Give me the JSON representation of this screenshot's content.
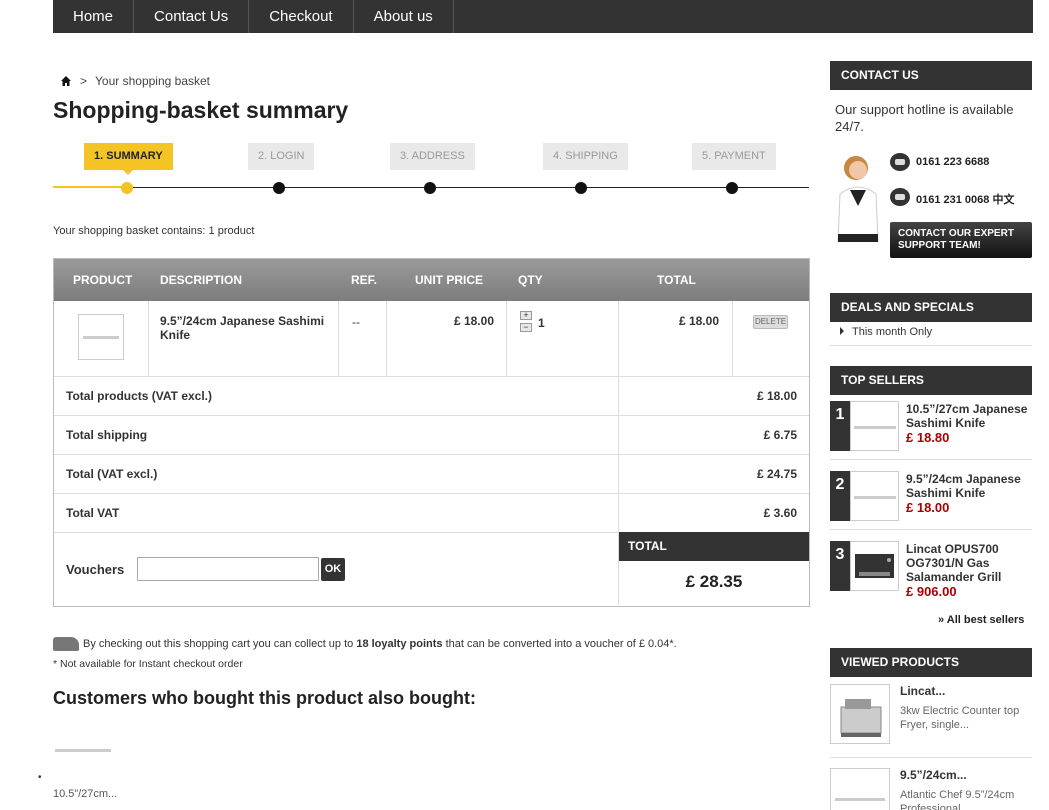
{
  "nav": {
    "items": [
      "Home",
      "Contact Us",
      "Checkout",
      "About us"
    ]
  },
  "breadcrumb": {
    "sep": ">",
    "current": "Your shopping basket"
  },
  "page_title": "Shopping-basket summary",
  "steps": [
    "1. SUMMARY",
    "2. LOGIN",
    "3. ADDRESS",
    "4. SHIPPING",
    "5. PAYMENT"
  ],
  "contains": "Your shopping basket contains: 1 product",
  "table": {
    "headers": {
      "product": "PRODUCT",
      "description": "DESCRIPTION",
      "ref": "REF.",
      "unit_price": "UNIT PRICE",
      "qty": "QTY",
      "total": "TOTAL"
    },
    "row": {
      "description": "9.5”/24cm Japanese Sashimi Knife",
      "ref": "--",
      "unit_price": "£ 18.00",
      "qty": "1",
      "total": "£ 18.00",
      "delete": "DELETE",
      "plus": "+",
      "minus": "−"
    }
  },
  "summary": [
    {
      "label": "Total products (VAT excl.)",
      "value": "£ 18.00"
    },
    {
      "label": "Total shipping",
      "value": "£ 6.75"
    },
    {
      "label": "Total (VAT excl.)",
      "value": "£ 24.75"
    },
    {
      "label": "Total VAT",
      "value": "£ 3.60"
    }
  ],
  "voucher": {
    "label": "Vouchers",
    "value": "",
    "ok": "OK"
  },
  "total": {
    "label": "TOTAL",
    "value": "£ 28.35"
  },
  "loyalty": {
    "pre": "By checking out this shopping cart you can collect up to ",
    "points": "18 loyalty points",
    "post": " that can be converted into a voucher of £ 0.04*."
  },
  "note": "* Not available for Instant checkout order",
  "also": {
    "title": "Customers who bought this product also bought:",
    "bullet": "•",
    "label": "10.5”/27cm..."
  },
  "sidebar": {
    "contact": {
      "title": "CONTACT US",
      "text": "Our support hotline is available 24/7.",
      "phone1": "0161 223 6688",
      "phone2": "0161 231 0068 中文",
      "button": "CONTACT OUR EXPERT SUPPORT TEAM!"
    },
    "deals": {
      "title": "DEALS AND SPECIALS",
      "item": "This month Only"
    },
    "top_sellers": {
      "title": "TOP SELLERS",
      "items": [
        {
          "rank": "1",
          "name": "10.5”/27cm Japanese Sashimi Knife",
          "price": "£ 18.80"
        },
        {
          "rank": "2",
          "name": "9.5”/24cm Japanese Sashimi Knife",
          "price": "£ 18.00"
        },
        {
          "rank": "3",
          "name": "Lincat OPUS700 OG7301/N Gas Salamander Grill",
          "price": "£ 906.00"
        }
      ],
      "all": "» All best sellers"
    },
    "viewed": {
      "title": "VIEWED PRODUCTS",
      "items": [
        {
          "name": "Lincat...",
          "desc": "3kw Electric Counter top Fryer, single..."
        },
        {
          "name": "9.5”/24cm...",
          "desc": "Atlantic Chef 9.5”/24cm Professional"
        }
      ]
    }
  },
  "colors": {
    "accent": "#f4c425",
    "dark": "#333333",
    "price": "#aa0000"
  }
}
